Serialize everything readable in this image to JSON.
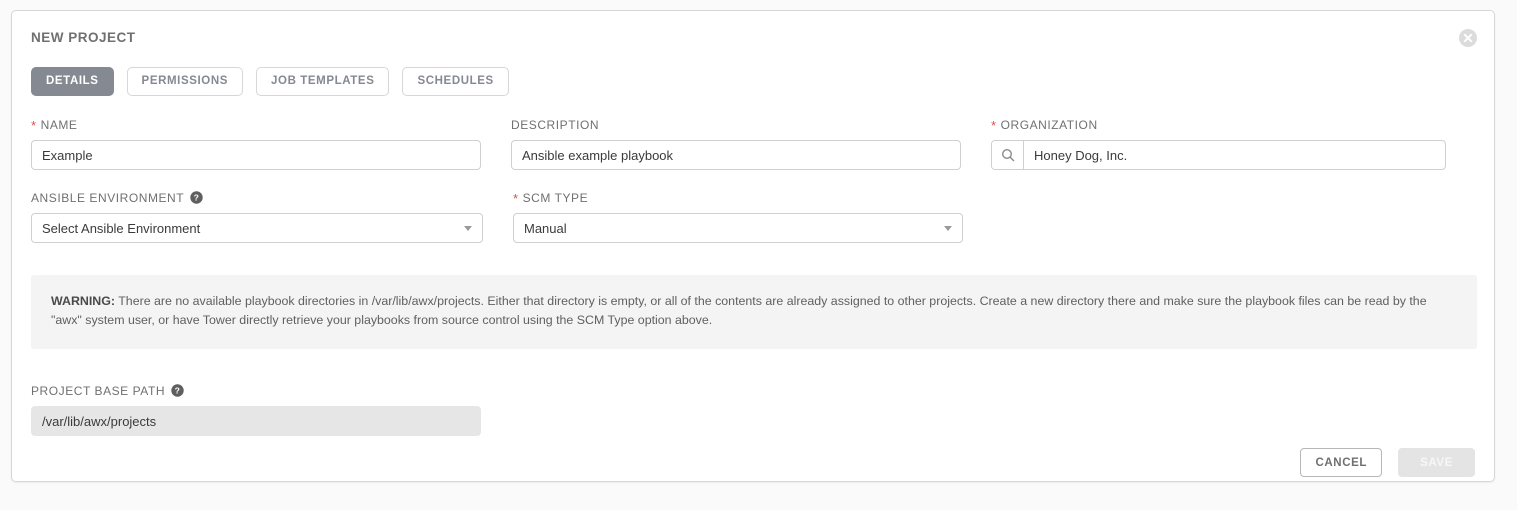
{
  "panel": {
    "title": "NEW PROJECT",
    "close_icon": "close-circle-icon"
  },
  "tabs": [
    {
      "label": "DETAILS",
      "active": true
    },
    {
      "label": "PERMISSIONS",
      "active": false
    },
    {
      "label": "JOB TEMPLATES",
      "active": false
    },
    {
      "label": "SCHEDULES",
      "active": false
    }
  ],
  "fields": {
    "name": {
      "label": "NAME",
      "required": true,
      "value": "Example",
      "placeholder": ""
    },
    "description": {
      "label": "DESCRIPTION",
      "required": false,
      "value": "Ansible example playbook",
      "placeholder": ""
    },
    "organization": {
      "label": "ORGANIZATION",
      "required": true,
      "value": "Honey Dog, Inc.",
      "placeholder": "",
      "lookup_icon": "search-icon"
    },
    "ansible_environment": {
      "label": "ANSIBLE ENVIRONMENT",
      "required": false,
      "value": "Select Ansible Environment",
      "help_icon": "question-circle-icon"
    },
    "scm_type": {
      "label": "SCM TYPE",
      "required": true,
      "value": "Manual"
    },
    "project_base_path": {
      "label": "PROJECT BASE PATH",
      "required": false,
      "value": "/var/lib/awx/projects",
      "help_icon": "question-circle-icon"
    }
  },
  "warning": {
    "prefix": "WARNING:",
    "text": " There are no available playbook directories in /var/lib/awx/projects. Either that directory is empty, or all of the contents are already assigned to other projects. Create a new directory there and make sure the playbook files can be read by the \"awx\" system user, or have Tower directly retrieve your playbooks from source control using the SCM Type option above."
  },
  "actions": {
    "cancel_label": "CANCEL",
    "save_label": "SAVE"
  },
  "colors": {
    "required_asterisk": "#d9534f",
    "active_tab_bg": "#848992",
    "label_text": "#707070",
    "warning_bg": "#f4f4f4",
    "readonly_bg": "#e6e6e6"
  }
}
